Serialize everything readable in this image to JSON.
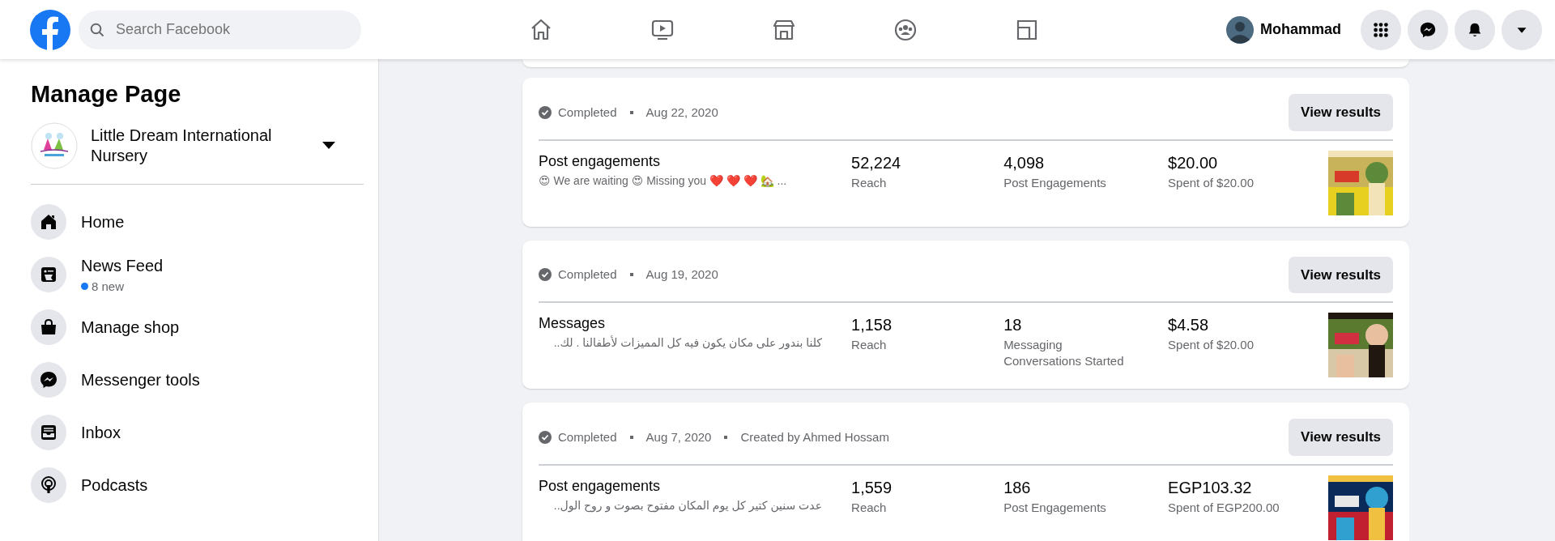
{
  "header": {
    "search": {
      "placeholder": "Search Facebook"
    },
    "nav": [
      {
        "kind": "home",
        "selected": false
      },
      {
        "kind": "video",
        "selected": false
      },
      {
        "kind": "store",
        "selected": false
      },
      {
        "kind": "groups",
        "selected": false
      },
      {
        "kind": "gaming",
        "selected": false
      }
    ],
    "profile": {
      "name": "Mohammad"
    },
    "actions": [
      {
        "kind": "menu"
      },
      {
        "kind": "messenger"
      },
      {
        "kind": "notifications"
      },
      {
        "kind": "account"
      }
    ]
  },
  "sidebar": {
    "title": "Manage Page",
    "page": {
      "name": "Little Dream International Nursery"
    },
    "items": [
      {
        "kind": "home",
        "label": "Home"
      },
      {
        "kind": "feed",
        "label": "News Feed",
        "badge": "8 new"
      },
      {
        "kind": "shop",
        "label": "Manage shop"
      },
      {
        "kind": "messenger",
        "label": "Messenger tools"
      },
      {
        "kind": "inbox",
        "label": "Inbox"
      },
      {
        "kind": "podcast",
        "label": "Podcasts"
      }
    ]
  },
  "ads": [
    {
      "status": "Completed",
      "date": "Aug 22, 2020",
      "title": "Post engagements",
      "text": "😍 We are waiting 😍 Missing you ❤️ ❤️ ❤️ 🏡 ...",
      "button": "View results",
      "metrics": [
        {
          "value": "52,224",
          "label": "Reach"
        },
        {
          "value": "4,098",
          "label": "Post Engagements"
        },
        {
          "value": "$20.00",
          "label": "Spent of $20.00"
        }
      ],
      "thumbnail": {
        "kind": "picture"
      }
    },
    {
      "status": "Completed",
      "date": "Aug 19, 2020",
      "title": "Messages",
      "text": "كلنا بندور على مكان يكون فيه كل المميزات لأطفالنا . لك..",
      "button": "View results",
      "metrics": [
        {
          "value": "1,158",
          "label": "Reach"
        },
        {
          "value": "18",
          "label": "Messaging Conversations Started"
        },
        {
          "value": "$4.58",
          "label": "Spent of $20.00"
        }
      ],
      "thumbnail": {
        "kind": "picture"
      }
    },
    {
      "status": "Completed",
      "date": "Aug 7, 2020",
      "creator": "Created by Ahmed Hossam",
      "title": "Post engagements",
      "text": "عدت سنين كتير كل يوم المكان مفتوح بصوت و روح الول..",
      "button": "View results",
      "metrics": [
        {
          "value": "1,559",
          "label": "Reach"
        },
        {
          "value": "186",
          "label": "Post Engagements"
        },
        {
          "value": "EGP103.32",
          "label": "Spent of EGP200.00"
        }
      ],
      "thumbnail": {
        "kind": "picture"
      }
    }
  ]
}
